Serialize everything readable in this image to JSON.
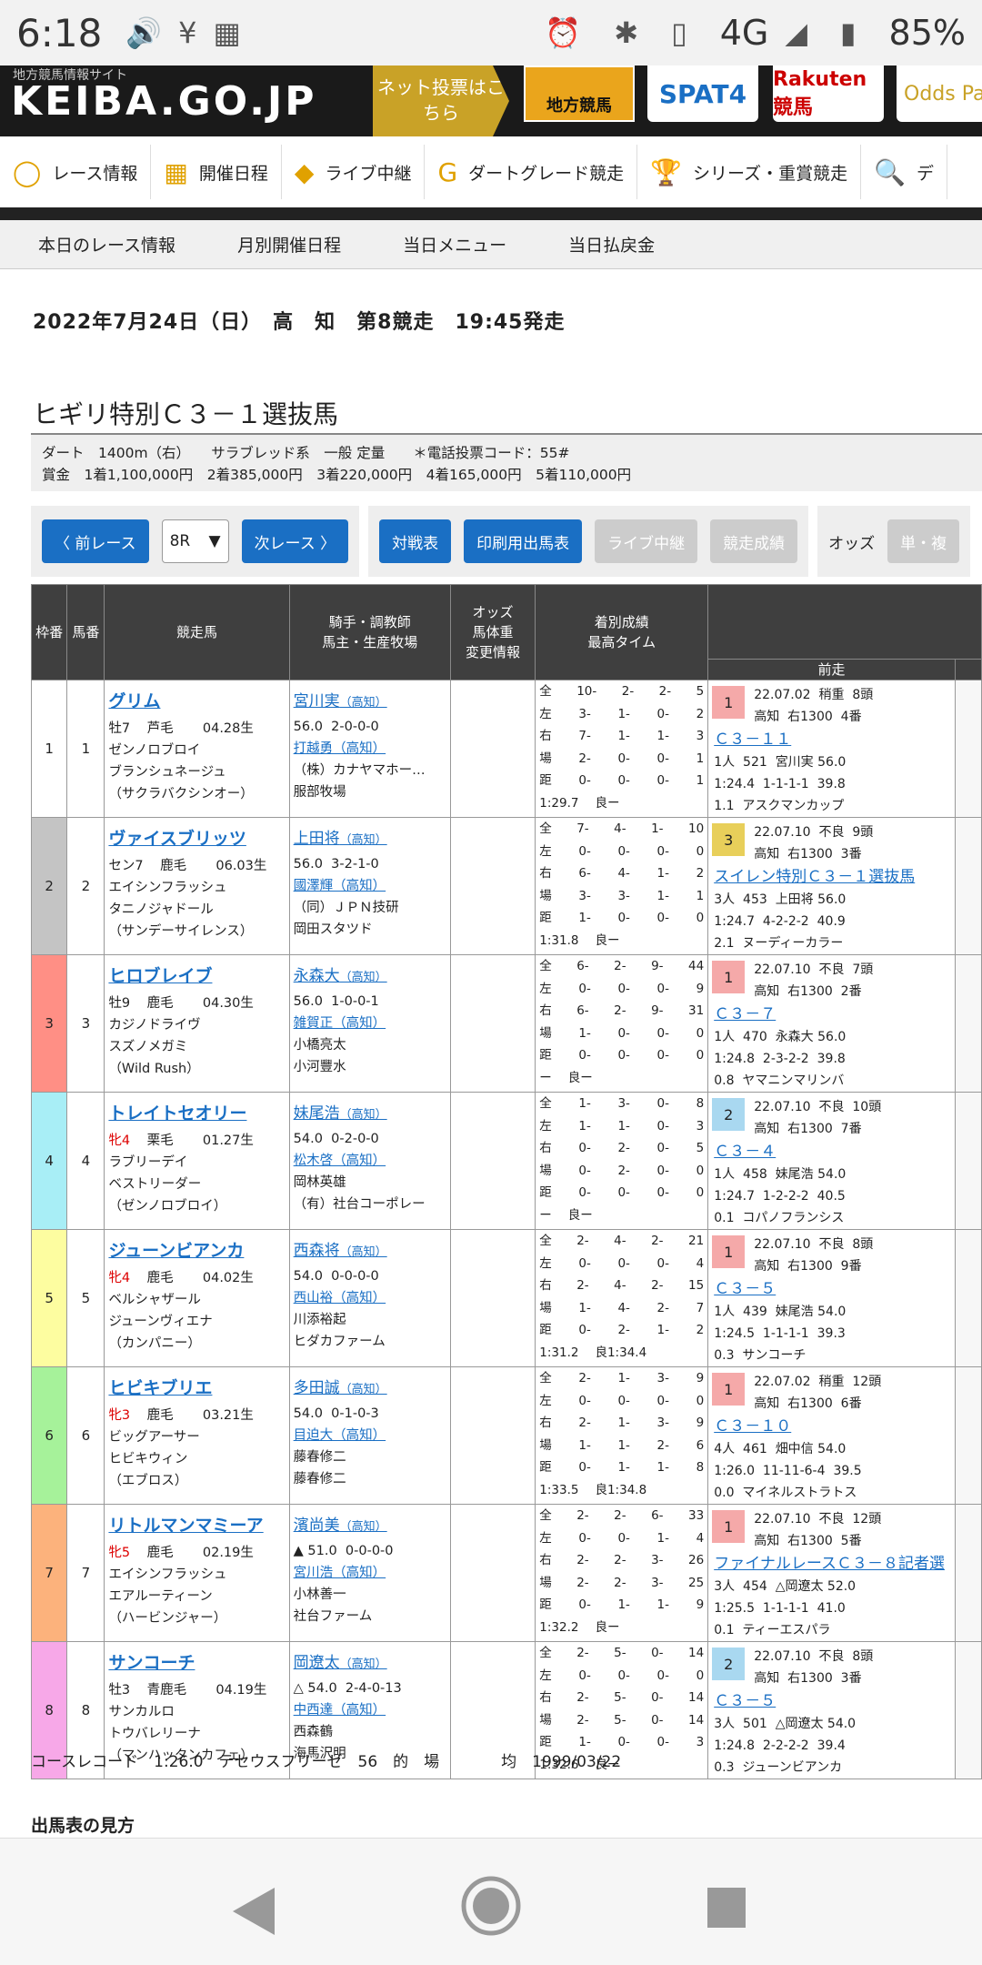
{
  "status": {
    "time": "6:18",
    "network": "4G",
    "battery": "85%"
  },
  "brand": {
    "subtitle": "地方競馬情報サイト",
    "logo": "KEIBA.GO.JP",
    "netbet": "ネット投票はこちら",
    "chiho": "地方競馬",
    "spat4": "SPAT4",
    "rakuten": "Rakuten競馬",
    "oddspark": "Odds Park"
  },
  "mainnav": [
    "レース情報",
    "開催日程",
    "ライブ中継",
    "ダートグレード競走",
    "シリーズ・重賞競走",
    "デ"
  ],
  "subnav": [
    "本日のレース情報",
    "月別開催日程",
    "当日メニュー",
    "当日払戻金"
  ],
  "race": {
    "header": "2022年7月24日（日）　高　知　第8競走　19:45発走",
    "name": "ヒギリ特別Ｃ３－１選抜馬",
    "cond1": "ダート　1400m（右）　　サラブレッド系　一般 定量　　＊電話投票コード：55#",
    "cond2": "賞金　1着1,100,000円　2着385,000円　3着220,000円　4着165,000円　5着110,000円"
  },
  "controls": {
    "prev": "前レース",
    "select": "8R",
    "next": "次レース",
    "vs": "対戦表",
    "print": "印刷用出馬表",
    "live": "ライブ中継",
    "result": "競走成績",
    "odds": "オッズ",
    "win": "単・複"
  },
  "headers": {
    "waku": "枠番",
    "uma": "馬番",
    "horse": "競走馬",
    "jockey": "騎手・調教師\n馬主・生産牧場",
    "odds": "オッズ\n馬体重\n変更情報",
    "rec": "着別成績\n最高タイム",
    "prev": "前走"
  },
  "entries": [
    {
      "waku": "1",
      "num": "1",
      "color": "#ffffff",
      "name": "グリム",
      "sex": "牡7",
      "coat": "芦毛",
      "birth": "04.28生",
      "sire": "ゼンノロブロイ",
      "dam": "ブランシュネージュ",
      "damsire": "（サクラバクシンオー）",
      "jockey": "宮川実",
      "jreg": "（高知）",
      "weight": "56.0",
      "jrec": "2-0-0-0",
      "trainer": "打越勇（高知）",
      "owner": "（株）カナヤマホー…",
      "breeder": "服部牧場",
      "rec": [
        [
          "全",
          "10-",
          "2-",
          "2-",
          "5"
        ],
        [
          "左",
          "3-",
          "1-",
          "0-",
          "2"
        ],
        [
          "右",
          "7-",
          "1-",
          "1-",
          "3"
        ],
        [
          "場",
          "2-",
          "0-",
          "0-",
          "1"
        ],
        [
          "距",
          "0-",
          "0-",
          "0-",
          "1"
        ],
        [
          "1:29.7",
          "良ー",
          "",
          ""
        ]
      ],
      "prev": {
        "place": "1",
        "pc": "#f5a9a9",
        "date": "22.07.02",
        "cond": "稍重",
        "heads": "8頭",
        "track": "高知",
        "dist": "右1300",
        "gate": "4番",
        "cls": "Ｃ３－１１",
        "pop": "1人",
        "bw": "521",
        "jk": "宮川実",
        "jw": "56.0",
        "time": "1:24.4",
        "pass": "1-1-1-1",
        "last": "39.8",
        "diff": "1.1",
        "winner": "アスクマンカップ"
      }
    },
    {
      "waku": "2",
      "num": "2",
      "color": "#c4c4c4",
      "name": "ヴァイスブリッツ",
      "sex": "セン7",
      "coat": "鹿毛",
      "birth": "06.03生",
      "sire": "エイシンフラッシュ",
      "dam": "タニノジャドール",
      "damsire": "（サンデーサイレンス）",
      "jockey": "上田将",
      "jreg": "（高知）",
      "weight": "56.0",
      "jrec": "3-2-1-0",
      "trainer": "國澤輝（高知）",
      "owner": "（同）ＪＰＮ技研",
      "breeder": "岡田スタツド",
      "rec": [
        [
          "全",
          "7-",
          "4-",
          "1-",
          "10"
        ],
        [
          "左",
          "0-",
          "0-",
          "0-",
          "0"
        ],
        [
          "右",
          "6-",
          "4-",
          "1-",
          "2"
        ],
        [
          "場",
          "3-",
          "3-",
          "1-",
          "1"
        ],
        [
          "距",
          "1-",
          "0-",
          "0-",
          "0"
        ],
        [
          "1:31.8",
          "良ー",
          "",
          ""
        ]
      ],
      "prev": {
        "place": "3",
        "pc": "#e8cf5a",
        "date": "22.07.10",
        "cond": "不良",
        "heads": "9頭",
        "track": "高知",
        "dist": "右1300",
        "gate": "3番",
        "cls": "スイレン特別Ｃ３－１選抜馬",
        "pop": "3人",
        "bw": "453",
        "jk": "上田将",
        "jw": "56.0",
        "time": "1:24.7",
        "pass": "4-2-2-2",
        "last": "40.9",
        "diff": "2.1",
        "winner": "ヌーディーカラー"
      }
    },
    {
      "waku": "3",
      "num": "3",
      "color": "#ff8f85",
      "name": "ヒロブレイブ",
      "sex": "牡9",
      "coat": "鹿毛",
      "birth": "04.30生",
      "sire": "カジノドライヴ",
      "dam": "スズノメガミ",
      "damsire": "（Wild Rush）",
      "jockey": "永森大",
      "jreg": "（高知）",
      "weight": "56.0",
      "jrec": "1-0-0-1",
      "trainer": "雑賀正（高知）",
      "owner": "小橋亮太",
      "breeder": "小河豐水",
      "rec": [
        [
          "全",
          "6-",
          "2-",
          "9-",
          "44"
        ],
        [
          "左",
          "0-",
          "0-",
          "0-",
          "9"
        ],
        [
          "右",
          "6-",
          "2-",
          "9-",
          "31"
        ],
        [
          "場",
          "1-",
          "0-",
          "0-",
          "0"
        ],
        [
          "距",
          "0-",
          "0-",
          "0-",
          "0"
        ],
        [
          "ー",
          "良ー",
          "",
          ""
        ]
      ],
      "prev": {
        "place": "1",
        "pc": "#f5a9a9",
        "date": "22.07.10",
        "cond": "不良",
        "heads": "7頭",
        "track": "高知",
        "dist": "右1300",
        "gate": "2番",
        "cls": "Ｃ３－７",
        "pop": "1人",
        "bw": "470",
        "jk": "永森大",
        "jw": "56.0",
        "time": "1:24.8",
        "pass": "2-3-2-2",
        "last": "39.8",
        "diff": "0.8",
        "winner": "ヤマニンマリンバ"
      }
    },
    {
      "waku": "4",
      "num": "4",
      "color": "#a8eef6",
      "name": "トレイトセオリー",
      "sex": "牝4",
      "coat": "栗毛",
      "birth": "01.27生",
      "sire": "ラブリーデイ",
      "dam": "ベストリーダー",
      "damsire": "（ゼンノロブロイ）",
      "jockey": "妹尾浩",
      "jreg": "（高知）",
      "weight": "54.0",
      "jrec": "0-2-0-0",
      "trainer": "松木啓（高知）",
      "owner": "岡林英雄",
      "breeder": "（有）社台コーポレー",
      "rec": [
        [
          "全",
          "1-",
          "3-",
          "0-",
          "8"
        ],
        [
          "左",
          "1-",
          "1-",
          "0-",
          "3"
        ],
        [
          "右",
          "0-",
          "2-",
          "0-",
          "5"
        ],
        [
          "場",
          "0-",
          "2-",
          "0-",
          "0"
        ],
        [
          "距",
          "0-",
          "0-",
          "0-",
          "0"
        ],
        [
          "ー",
          "良ー",
          "",
          ""
        ]
      ],
      "prev": {
        "place": "2",
        "pc": "#a9d8f0",
        "date": "22.07.10",
        "cond": "不良",
        "heads": "10頭",
        "track": "高知",
        "dist": "右1300",
        "gate": "7番",
        "cls": "Ｃ３－４",
        "pop": "1人",
        "bw": "458",
        "jk": "妹尾浩",
        "jw": "54.0",
        "time": "1:24.7",
        "pass": "1-2-2-2",
        "last": "40.5",
        "diff": "0.1",
        "winner": "コパノフランシス"
      }
    },
    {
      "waku": "5",
      "num": "5",
      "color": "#fdfda0",
      "name": "ジューンビアンカ",
      "sex": "牝4",
      "coat": "鹿毛",
      "birth": "04.02生",
      "sire": "ベルシャザール",
      "dam": "ジューンヴィエナ",
      "damsire": "（カンパニー）",
      "jockey": "西森将",
      "jreg": "（高知）",
      "weight": "54.0",
      "jrec": "0-0-0-0",
      "trainer": "西山裕（高知）",
      "owner": "川添裕起",
      "breeder": "ヒダカファーム",
      "rec": [
        [
          "全",
          "2-",
          "4-",
          "2-",
          "21"
        ],
        [
          "左",
          "0-",
          "0-",
          "0-",
          "4"
        ],
        [
          "右",
          "2-",
          "4-",
          "2-",
          "15"
        ],
        [
          "場",
          "1-",
          "4-",
          "2-",
          "7"
        ],
        [
          "距",
          "0-",
          "2-",
          "1-",
          "2"
        ],
        [
          "1:31.2",
          "良1:34.4",
          "",
          ""
        ]
      ],
      "prev": {
        "place": "1",
        "pc": "#f5a9a9",
        "date": "22.07.10",
        "cond": "不良",
        "heads": "8頭",
        "track": "高知",
        "dist": "右1300",
        "gate": "9番",
        "cls": "Ｃ３－５",
        "pop": "1人",
        "bw": "439",
        "jk": "妹尾浩",
        "jw": "54.0",
        "time": "1:24.5",
        "pass": "1-1-1-1",
        "last": "39.3",
        "diff": "0.3",
        "winner": "サンコーチ"
      }
    },
    {
      "waku": "6",
      "num": "6",
      "color": "#a6f29a",
      "name": "ヒビキブリエ",
      "sex": "牝3",
      "coat": "鹿毛",
      "birth": "03.21生",
      "sire": "ビッグアーサー",
      "dam": "ヒビキウィン",
      "damsire": "（エブロス）",
      "jockey": "多田誠",
      "jreg": "（高知）",
      "weight": "54.0",
      "jrec": "0-1-0-3",
      "trainer": "目迫大（高知）",
      "owner": "藤春修二",
      "breeder": "藤春修二",
      "rec": [
        [
          "全",
          "2-",
          "1-",
          "3-",
          "9"
        ],
        [
          "左",
          "0-",
          "0-",
          "0-",
          "0"
        ],
        [
          "右",
          "2-",
          "1-",
          "3-",
          "9"
        ],
        [
          "場",
          "1-",
          "1-",
          "2-",
          "6"
        ],
        [
          "距",
          "0-",
          "1-",
          "1-",
          "8"
        ],
        [
          "1:33.5",
          "良1:34.8",
          "",
          ""
        ]
      ],
      "prev": {
        "place": "1",
        "pc": "#f5a9a9",
        "date": "22.07.02",
        "cond": "稍重",
        "heads": "12頭",
        "track": "高知",
        "dist": "右1300",
        "gate": "6番",
        "cls": "Ｃ３－１０",
        "pop": "4人",
        "bw": "461",
        "jk": "畑中信",
        "jw": "54.0",
        "time": "1:26.0",
        "pass": "11-11-6-4",
        "last": "39.5",
        "diff": "0.0",
        "winner": "マイネルストラトス"
      }
    },
    {
      "waku": "7",
      "num": "7",
      "color": "#fcb27c",
      "name": "リトルマンマミーア",
      "sex": "牝5",
      "coat": "鹿毛",
      "birth": "02.19生",
      "sire": "エイシンフラッシュ",
      "dam": "エアルーティーン",
      "damsire": "（ハービンジャー）",
      "jockey": "濱尚美",
      "jreg": "（高知）",
      "weight": "▲ 51.0",
      "jrec": "0-0-0-0",
      "trainer": "宮川浩（高知）",
      "owner": "小林善一",
      "breeder": "社台ファーム",
      "rec": [
        [
          "全",
          "2-",
          "2-",
          "6-",
          "33"
        ],
        [
          "左",
          "0-",
          "0-",
          "1-",
          "4"
        ],
        [
          "右",
          "2-",
          "2-",
          "3-",
          "26"
        ],
        [
          "場",
          "2-",
          "2-",
          "3-",
          "25"
        ],
        [
          "距",
          "0-",
          "1-",
          "1-",
          "9"
        ],
        [
          "1:32.2",
          "良ー",
          "",
          ""
        ]
      ],
      "prev": {
        "place": "1",
        "pc": "#f5a9a9",
        "date": "22.07.10",
        "cond": "不良",
        "heads": "12頭",
        "track": "高知",
        "dist": "右1300",
        "gate": "5番",
        "cls": "ファイナルレースＣ３－８記者選",
        "pop": "3人",
        "bw": "454",
        "jk": "△岡遼太",
        "jw": "52.0",
        "time": "1:25.5",
        "pass": "1-1-1-1",
        "last": "41.0",
        "diff": "0.1",
        "winner": "ティーエスパラ"
      }
    },
    {
      "waku": "8",
      "num": "8",
      "color": "#f7a8e8",
      "name": "サンコーチ",
      "sex": "牡3",
      "coat": "青鹿毛",
      "birth": "04.19生",
      "sire": "サンカルロ",
      "dam": "トウバレリーナ",
      "damsire": "（マンハッタンカフェ）",
      "jockey": "岡遼太",
      "jreg": "（高知）",
      "weight": "△ 54.0",
      "jrec": "2-4-0-13",
      "trainer": "中西達（高知）",
      "owner": "西森鶴",
      "breeder": "海馬沢明",
      "rec": [
        [
          "全",
          "2-",
          "5-",
          "0-",
          "14"
        ],
        [
          "左",
          "0-",
          "0-",
          "0-",
          "0"
        ],
        [
          "右",
          "2-",
          "5-",
          "0-",
          "14"
        ],
        [
          "場",
          "2-",
          "5-",
          "0-",
          "14"
        ],
        [
          "距",
          "1-",
          "0-",
          "0-",
          "3"
        ],
        [
          "1:32.6",
          "良ー",
          "",
          ""
        ]
      ],
      "prev": {
        "place": "2",
        "pc": "#a9d8f0",
        "date": "22.07.10",
        "cond": "不良",
        "heads": "8頭",
        "track": "高知",
        "dist": "右1300",
        "gate": "3番",
        "cls": "Ｃ３－５",
        "pop": "3人",
        "bw": "501",
        "jk": "△岡遼太",
        "jw": "54.0",
        "time": "1:24.8",
        "pass": "2-2-2-2",
        "last": "39.4",
        "diff": "0.3",
        "winner": "ジューンビアンカ"
      }
    }
  ],
  "record": "コースレコード　1:26.0　テセウスフリーゼ　56　的　場　　　　均　1999/03/22",
  "howto": "出馬表の見方"
}
